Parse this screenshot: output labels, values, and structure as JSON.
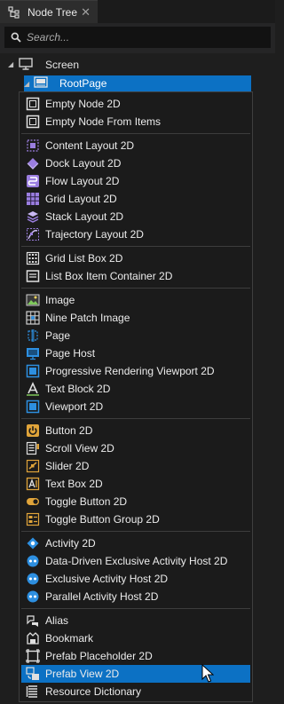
{
  "panel": {
    "title": "Node Tree",
    "close_glyph": "✕"
  },
  "search": {
    "placeholder": "Search...",
    "value": ""
  },
  "tree": {
    "screen_label": "Screen",
    "root_label": "RootPage"
  },
  "menu": {
    "groups": [
      {
        "items": [
          {
            "label": "Empty Node 2D",
            "icon": "empty-node-icon"
          },
          {
            "label": "Empty Node From Items",
            "icon": "empty-node-icon"
          }
        ]
      },
      {
        "items": [
          {
            "label": "Content Layout 2D",
            "icon": "content-layout-icon"
          },
          {
            "label": "Dock Layout 2D",
            "icon": "dock-layout-icon"
          },
          {
            "label": "Flow Layout 2D",
            "icon": "flow-layout-icon"
          },
          {
            "label": "Grid Layout 2D",
            "icon": "grid-layout-icon"
          },
          {
            "label": "Stack Layout 2D",
            "icon": "stack-layout-icon"
          },
          {
            "label": "Trajectory Layout 2D",
            "icon": "trajectory-layout-icon"
          }
        ]
      },
      {
        "items": [
          {
            "label": "Grid List Box 2D",
            "icon": "grid-list-box-icon"
          },
          {
            "label": "List Box Item Container 2D",
            "icon": "list-box-item-container-icon"
          }
        ]
      },
      {
        "items": [
          {
            "label": "Image",
            "icon": "image-icon"
          },
          {
            "label": "Nine Patch Image",
            "icon": "nine-patch-image-icon"
          },
          {
            "label": "Page",
            "icon": "page-icon"
          },
          {
            "label": "Page Host",
            "icon": "page-host-icon"
          },
          {
            "label": "Progressive Rendering Viewport 2D",
            "icon": "progressive-viewport-icon"
          },
          {
            "label": "Text Block 2D",
            "icon": "text-block-icon"
          },
          {
            "label": "Viewport 2D",
            "icon": "viewport-icon"
          }
        ]
      },
      {
        "items": [
          {
            "label": "Button 2D",
            "icon": "button-icon"
          },
          {
            "label": "Scroll View 2D",
            "icon": "scroll-view-icon"
          },
          {
            "label": "Slider 2D",
            "icon": "slider-icon"
          },
          {
            "label": "Text Box 2D",
            "icon": "text-box-icon"
          },
          {
            "label": "Toggle Button 2D",
            "icon": "toggle-button-icon"
          },
          {
            "label": "Toggle Button Group 2D",
            "icon": "toggle-button-group-icon"
          }
        ]
      },
      {
        "items": [
          {
            "label": "Activity 2D",
            "icon": "activity-icon"
          },
          {
            "label": "Data-Driven Exclusive Activity Host 2D",
            "icon": "data-driven-activity-host-icon"
          },
          {
            "label": "Exclusive Activity Host 2D",
            "icon": "exclusive-activity-host-icon"
          },
          {
            "label": "Parallel Activity Host 2D",
            "icon": "parallel-activity-host-icon"
          }
        ]
      },
      {
        "items": [
          {
            "label": "Alias",
            "icon": "alias-icon"
          },
          {
            "label": "Bookmark",
            "icon": "bookmark-icon"
          },
          {
            "label": "Prefab Placeholder 2D",
            "icon": "prefab-placeholder-icon"
          },
          {
            "label": "Prefab View 2D",
            "icon": "prefab-view-icon",
            "highlighted": true
          },
          {
            "label": "Resource Dictionary",
            "icon": "resource-dictionary-icon"
          }
        ]
      }
    ]
  },
  "colors": {
    "background": "#1e1e1e",
    "selection": "#0c71c4",
    "menu_background": "#1b1b1b",
    "separator": "#3d3d3d",
    "icon_blue": "#2d8fe0",
    "icon_purple": "#9b7ee0",
    "icon_orange": "#e0a43a",
    "icon_green": "#7fc95b"
  }
}
